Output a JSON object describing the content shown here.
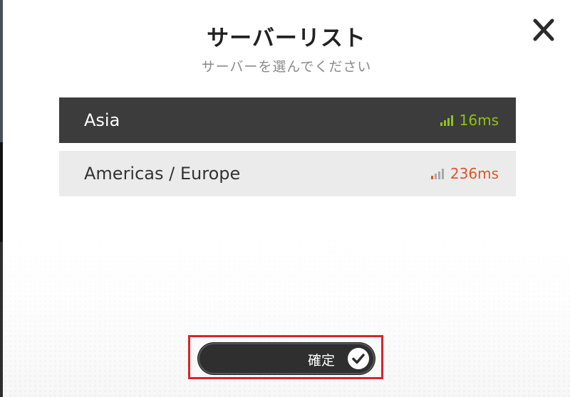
{
  "dialog": {
    "title": "サーバーリスト",
    "subtitle": "サーバーを選んでください"
  },
  "servers": [
    {
      "name": "Asia",
      "ping": "16ms",
      "selected": true,
      "signal_bars_active": 4,
      "ping_color": "#8cc21a"
    },
    {
      "name": "Americas / Europe",
      "ping": "236ms",
      "selected": false,
      "signal_bars_active": 1,
      "ping_color": "#e0542b"
    }
  ],
  "confirm": {
    "label": "確定",
    "icon": "checkmark-icon"
  },
  "icons": {
    "close": "close-icon",
    "signal": "signal-strength-icon"
  },
  "colors": {
    "selected_row": "#3c3c3c",
    "unselected_row": "#ebebeb",
    "ping_good": "#8cc21a",
    "ping_bad": "#e0542b",
    "highlight": "#d8242b"
  }
}
